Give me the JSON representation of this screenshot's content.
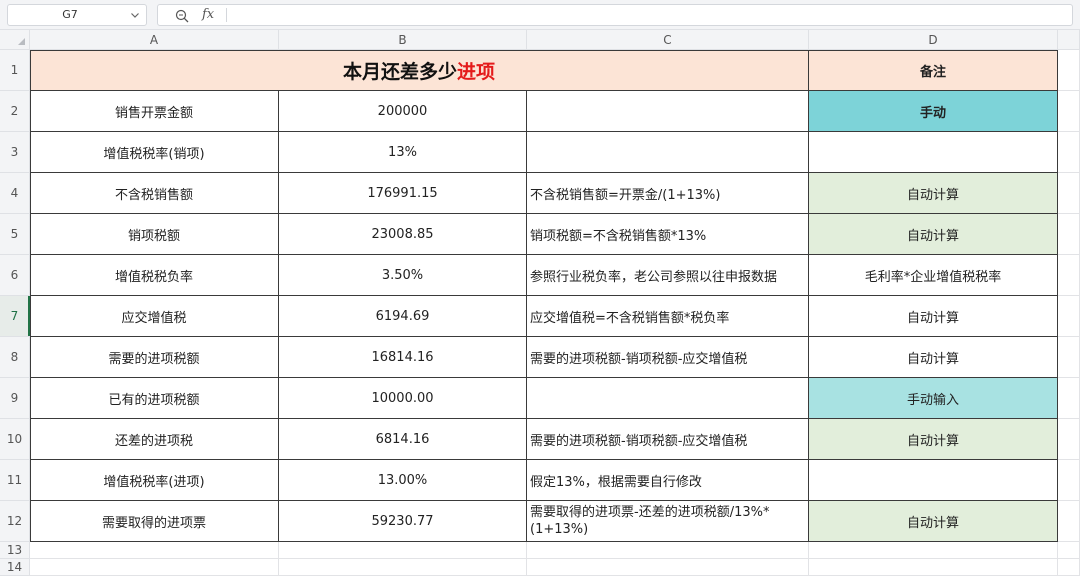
{
  "formula_bar": {
    "cell_ref": "G7",
    "fx_label": "fx",
    "formula": ""
  },
  "columns": [
    "A",
    "B",
    "C",
    "D"
  ],
  "rows": [
    "1",
    "2",
    "3",
    "4",
    "5",
    "6",
    "7",
    "8",
    "9",
    "10",
    "11",
    "12",
    "13",
    "14"
  ],
  "active_row": "7",
  "title": {
    "main": "本月还差多少",
    "highlight": "进项",
    "highlight_color": "#e41b1b"
  },
  "note_header": "备注",
  "colors": {
    "header_fill": "#fce4d6",
    "teal_fill": "#7dd3d8",
    "light_teal_fill": "#a8e2e2",
    "green_fill": "#e2eedb",
    "grid_border": "#3a3a3a"
  },
  "table": [
    {
      "label": "销售开票金额",
      "value": "200000",
      "formula": "",
      "note": "手动",
      "note_style": "teal-bold"
    },
    {
      "label": "增值税税率(销项)",
      "value": "13%",
      "formula": "",
      "note": "",
      "note_style": "none"
    },
    {
      "label": "不含税销售额",
      "value": "176991.15",
      "formula": "不含税销售额=开票金/(1+13%)",
      "note": "自动计算",
      "note_style": "green"
    },
    {
      "label": "销项税额",
      "value": "23008.85",
      "formula": "销项税额=不含税销售额*13%",
      "note": "自动计算",
      "note_style": "green"
    },
    {
      "label": "增值税税负率",
      "value": "3.50%",
      "formula": "参照行业税负率，老公司参照以往申报数据",
      "note": "毛利率*企业增值税税率",
      "note_style": "none"
    },
    {
      "label": "应交增值税",
      "value": "6194.69",
      "formula": "应交增值税=不含税销售额*税负率",
      "note": "自动计算",
      "note_style": "none"
    },
    {
      "label": "需要的进项税额",
      "value": "16814.16",
      "formula": "需要的进项税额-销项税额-应交增值税",
      "note": "自动计算",
      "note_style": "none"
    },
    {
      "label": "已有的进项税额",
      "value": "10000.00",
      "formula": "",
      "note": "手动输入",
      "note_style": "light-teal"
    },
    {
      "label": "还差的进项税",
      "value": "6814.16",
      "formula": "需要的进项税额-销项税额-应交增值税",
      "note": "自动计算",
      "note_style": "green"
    },
    {
      "label": "增值税税率(进项)",
      "value": "13.00%",
      "formula": "假定13%，根据需要自行修改",
      "note": "",
      "note_style": "none"
    },
    {
      "label": "需要取得的进项票",
      "value": "59230.77",
      "formula": "需要取得的进项票-还差的进项税额/13%*(1+13%)",
      "note": "自动计算",
      "note_style": "green"
    }
  ]
}
